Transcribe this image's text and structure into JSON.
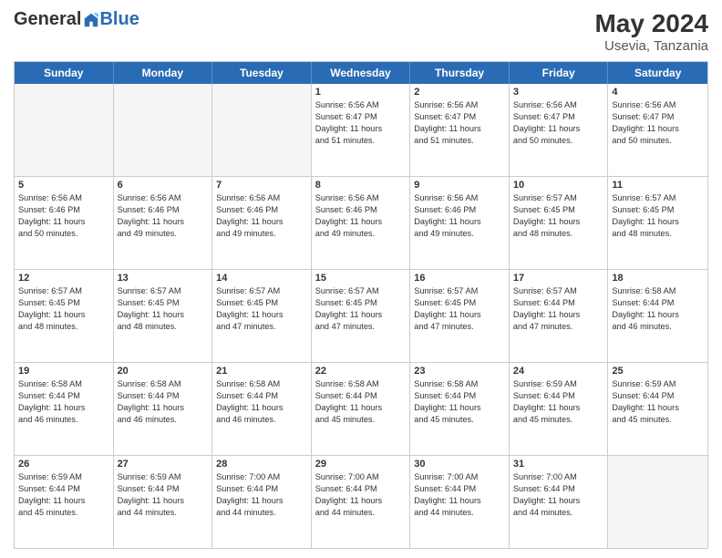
{
  "header": {
    "logo_general": "General",
    "logo_blue": "Blue",
    "month_year": "May 2024",
    "location": "Usevia, Tanzania"
  },
  "days_of_week": [
    "Sunday",
    "Monday",
    "Tuesday",
    "Wednesday",
    "Thursday",
    "Friday",
    "Saturday"
  ],
  "weeks": [
    [
      {
        "day": "",
        "info": ""
      },
      {
        "day": "",
        "info": ""
      },
      {
        "day": "",
        "info": ""
      },
      {
        "day": "1",
        "info": "Sunrise: 6:56 AM\nSunset: 6:47 PM\nDaylight: 11 hours\nand 51 minutes."
      },
      {
        "day": "2",
        "info": "Sunrise: 6:56 AM\nSunset: 6:47 PM\nDaylight: 11 hours\nand 51 minutes."
      },
      {
        "day": "3",
        "info": "Sunrise: 6:56 AM\nSunset: 6:47 PM\nDaylight: 11 hours\nand 50 minutes."
      },
      {
        "day": "4",
        "info": "Sunrise: 6:56 AM\nSunset: 6:47 PM\nDaylight: 11 hours\nand 50 minutes."
      }
    ],
    [
      {
        "day": "5",
        "info": "Sunrise: 6:56 AM\nSunset: 6:46 PM\nDaylight: 11 hours\nand 50 minutes."
      },
      {
        "day": "6",
        "info": "Sunrise: 6:56 AM\nSunset: 6:46 PM\nDaylight: 11 hours\nand 49 minutes."
      },
      {
        "day": "7",
        "info": "Sunrise: 6:56 AM\nSunset: 6:46 PM\nDaylight: 11 hours\nand 49 minutes."
      },
      {
        "day": "8",
        "info": "Sunrise: 6:56 AM\nSunset: 6:46 PM\nDaylight: 11 hours\nand 49 minutes."
      },
      {
        "day": "9",
        "info": "Sunrise: 6:56 AM\nSunset: 6:46 PM\nDaylight: 11 hours\nand 49 minutes."
      },
      {
        "day": "10",
        "info": "Sunrise: 6:57 AM\nSunset: 6:45 PM\nDaylight: 11 hours\nand 48 minutes."
      },
      {
        "day": "11",
        "info": "Sunrise: 6:57 AM\nSunset: 6:45 PM\nDaylight: 11 hours\nand 48 minutes."
      }
    ],
    [
      {
        "day": "12",
        "info": "Sunrise: 6:57 AM\nSunset: 6:45 PM\nDaylight: 11 hours\nand 48 minutes."
      },
      {
        "day": "13",
        "info": "Sunrise: 6:57 AM\nSunset: 6:45 PM\nDaylight: 11 hours\nand 48 minutes."
      },
      {
        "day": "14",
        "info": "Sunrise: 6:57 AM\nSunset: 6:45 PM\nDaylight: 11 hours\nand 47 minutes."
      },
      {
        "day": "15",
        "info": "Sunrise: 6:57 AM\nSunset: 6:45 PM\nDaylight: 11 hours\nand 47 minutes."
      },
      {
        "day": "16",
        "info": "Sunrise: 6:57 AM\nSunset: 6:45 PM\nDaylight: 11 hours\nand 47 minutes."
      },
      {
        "day": "17",
        "info": "Sunrise: 6:57 AM\nSunset: 6:44 PM\nDaylight: 11 hours\nand 47 minutes."
      },
      {
        "day": "18",
        "info": "Sunrise: 6:58 AM\nSunset: 6:44 PM\nDaylight: 11 hours\nand 46 minutes."
      }
    ],
    [
      {
        "day": "19",
        "info": "Sunrise: 6:58 AM\nSunset: 6:44 PM\nDaylight: 11 hours\nand 46 minutes."
      },
      {
        "day": "20",
        "info": "Sunrise: 6:58 AM\nSunset: 6:44 PM\nDaylight: 11 hours\nand 46 minutes."
      },
      {
        "day": "21",
        "info": "Sunrise: 6:58 AM\nSunset: 6:44 PM\nDaylight: 11 hours\nand 46 minutes."
      },
      {
        "day": "22",
        "info": "Sunrise: 6:58 AM\nSunset: 6:44 PM\nDaylight: 11 hours\nand 45 minutes."
      },
      {
        "day": "23",
        "info": "Sunrise: 6:58 AM\nSunset: 6:44 PM\nDaylight: 11 hours\nand 45 minutes."
      },
      {
        "day": "24",
        "info": "Sunrise: 6:59 AM\nSunset: 6:44 PM\nDaylight: 11 hours\nand 45 minutes."
      },
      {
        "day": "25",
        "info": "Sunrise: 6:59 AM\nSunset: 6:44 PM\nDaylight: 11 hours\nand 45 minutes."
      }
    ],
    [
      {
        "day": "26",
        "info": "Sunrise: 6:59 AM\nSunset: 6:44 PM\nDaylight: 11 hours\nand 45 minutes."
      },
      {
        "day": "27",
        "info": "Sunrise: 6:59 AM\nSunset: 6:44 PM\nDaylight: 11 hours\nand 44 minutes."
      },
      {
        "day": "28",
        "info": "Sunrise: 7:00 AM\nSunset: 6:44 PM\nDaylight: 11 hours\nand 44 minutes."
      },
      {
        "day": "29",
        "info": "Sunrise: 7:00 AM\nSunset: 6:44 PM\nDaylight: 11 hours\nand 44 minutes."
      },
      {
        "day": "30",
        "info": "Sunrise: 7:00 AM\nSunset: 6:44 PM\nDaylight: 11 hours\nand 44 minutes."
      },
      {
        "day": "31",
        "info": "Sunrise: 7:00 AM\nSunset: 6:44 PM\nDaylight: 11 hours\nand 44 minutes."
      },
      {
        "day": "",
        "info": ""
      }
    ]
  ]
}
